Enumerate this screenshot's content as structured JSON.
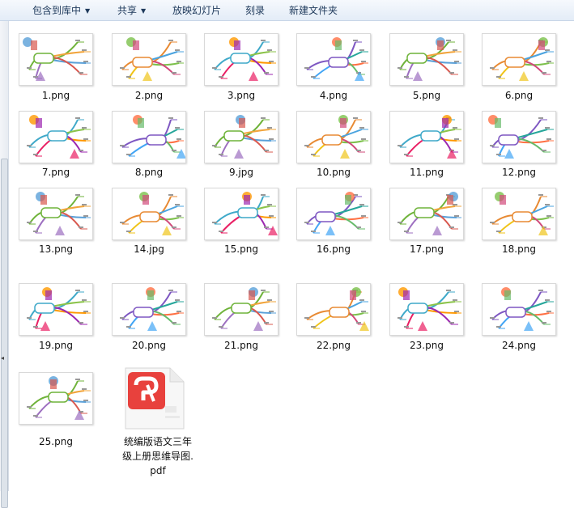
{
  "toolbar": {
    "items": [
      {
        "label": "包含到库中",
        "dropdown": true
      },
      {
        "label": "共享",
        "dropdown": true
      },
      {
        "label": "放映幻灯片",
        "dropdown": false
      },
      {
        "label": "刻录",
        "dropdown": false
      },
      {
        "label": "新建文件夹",
        "dropdown": false
      }
    ]
  },
  "files": [
    {
      "name": "1.png"
    },
    {
      "name": "2.png"
    },
    {
      "name": "3.png"
    },
    {
      "name": "4.png"
    },
    {
      "name": "5.png"
    },
    {
      "name": "6.png"
    },
    {
      "name": "7.png"
    },
    {
      "name": "8.png"
    },
    {
      "name": "9.jpg"
    },
    {
      "name": "10.png"
    },
    {
      "name": "11.png"
    },
    {
      "name": "12.png"
    },
    {
      "name": "13.png"
    },
    {
      "name": "14.jpg"
    },
    {
      "name": "15.png"
    },
    {
      "name": "16.png"
    },
    {
      "name": "17.png"
    },
    {
      "name": "18.png"
    },
    {
      "name": "19.png"
    },
    {
      "name": "20.png"
    },
    {
      "name": "21.png"
    },
    {
      "name": "22.png"
    },
    {
      "name": "23.png"
    },
    {
      "name": "24.png"
    },
    {
      "name": "25.png"
    }
  ],
  "pdf": {
    "name_line1": "统编版语文三年",
    "name_line2": "级上册思维导图.",
    "name_line3": "pdf"
  },
  "colors": {
    "pdf_red": "#e8413d",
    "toolbar_text": "#1e395b"
  }
}
